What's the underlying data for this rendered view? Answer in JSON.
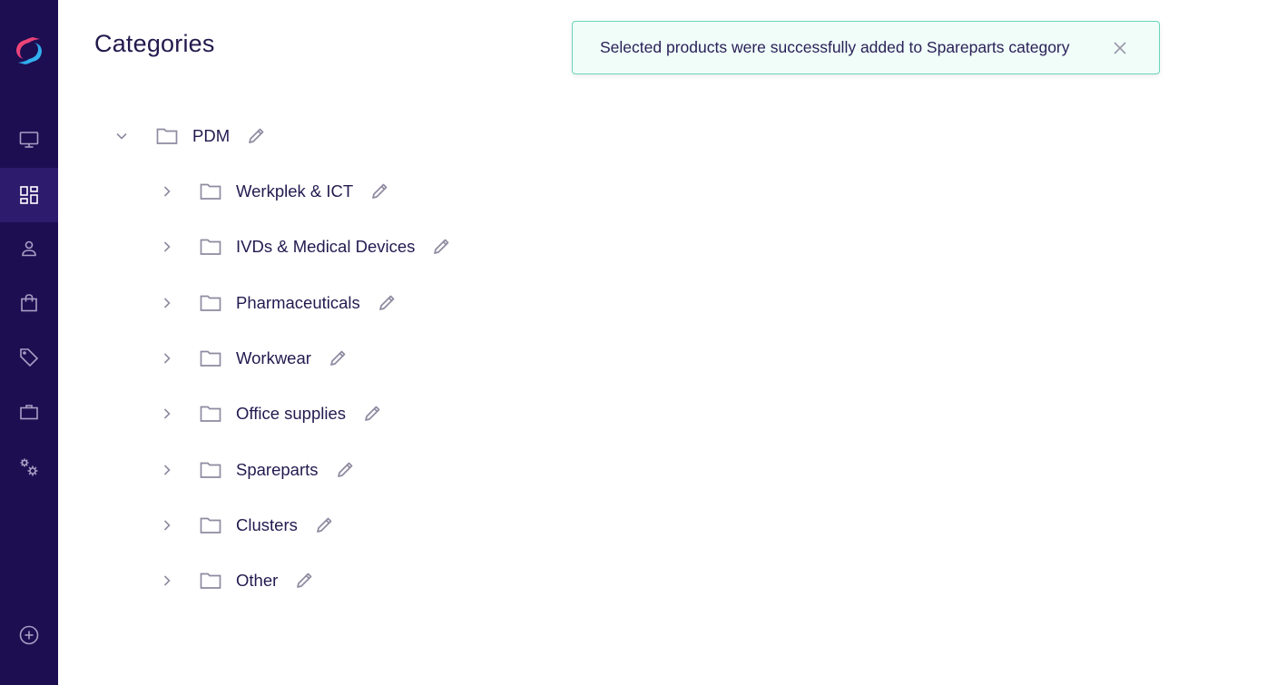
{
  "app": {
    "logo": "sync-logo-icon"
  },
  "sidebar": {
    "items": [
      {
        "name": "dashboard",
        "icon": "monitor-icon",
        "active": false
      },
      {
        "name": "categories",
        "icon": "dashboard-grid-icon",
        "active": true
      },
      {
        "name": "users",
        "icon": "user-icon",
        "active": false
      },
      {
        "name": "orders",
        "icon": "shopping-bag-icon",
        "active": false
      },
      {
        "name": "products",
        "icon": "tag-icon",
        "active": false
      },
      {
        "name": "suppliers",
        "icon": "briefcase-icon",
        "active": false
      },
      {
        "name": "settings",
        "icon": "gears-icon",
        "active": false
      }
    ],
    "add_button_icon": "plus-circle-icon"
  },
  "header": {
    "title": "Categories"
  },
  "toast": {
    "message": "Selected products were successfully added to Spareparts category",
    "type": "success",
    "close_icon": "close-icon"
  },
  "tree": {
    "root": {
      "label": "PDM",
      "expanded": true,
      "children": [
        {
          "label": "Werkplek & ICT",
          "expanded": false
        },
        {
          "label": "IVDs & Medical Devices",
          "expanded": false
        },
        {
          "label": "Pharmaceuticals",
          "expanded": false
        },
        {
          "label": "Workwear",
          "expanded": false
        },
        {
          "label": "Office supplies",
          "expanded": false
        },
        {
          "label": "Spareparts",
          "expanded": false
        },
        {
          "label": "Clusters",
          "expanded": false
        },
        {
          "label": "Other",
          "expanded": false
        }
      ]
    }
  },
  "colors": {
    "sidebar_bg": "#1d0e52",
    "sidebar_active_bg": "#2d1b6d",
    "toast_bg": "#f0fdf9",
    "toast_border": "#6ad7b9",
    "text_primary": "#231a4f",
    "icon_gray": "#8f8aa0"
  }
}
